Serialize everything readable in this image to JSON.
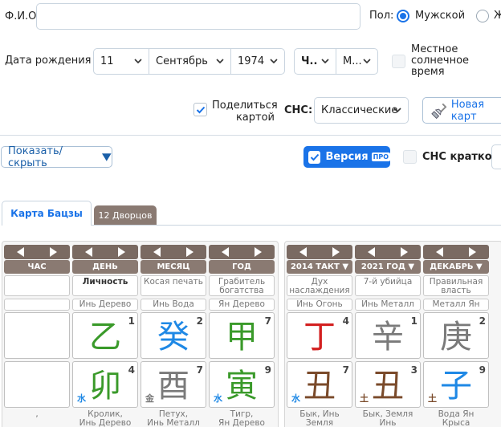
{
  "form": {
    "fio_label": "Ф.И.О.",
    "fio_value": "",
    "gender_label": "Пол:",
    "gender_male": "Мужской",
    "gender_female": "Ж",
    "birth_label": "Дата рождения",
    "day": "11",
    "month": "Сентябрь",
    "year": "1974",
    "hour": "Ч..",
    "minute": "М...",
    "solar_time_label": "Местное солнечное время",
    "share_label": "Поделиться картой",
    "sns_label": "СНС:",
    "sns_value": "Классические",
    "new_card_label": "Новая карт"
  },
  "toolbar": {
    "show_hide_label": "Показать/скрыть",
    "version_label": "Версия",
    "version_badge": "ПРО",
    "sns_short_label": "СНС кратко"
  },
  "tabs": [
    {
      "label": "Карта Бацзы"
    },
    {
      "label": "12 Дворцов"
    }
  ],
  "columns": [
    {
      "header": "ЧАС",
      "god": "",
      "stem_sub": "",
      "stem": "",
      "stem_num": "",
      "branch": "",
      "branch_num": "",
      "branch_elem": "",
      "bottom1": ",",
      "bottom2": ""
    },
    {
      "header": "ДЕНЬ",
      "god": "Личность",
      "stem_sub": "Инь Дерево",
      "stem": "乙",
      "stem_num": "1",
      "branch": "卯",
      "branch_num": "4",
      "branch_elem": "水",
      "bottom1": "Кролик,",
      "bottom2": "Инь Дерево"
    },
    {
      "header": "МЕСЯЦ",
      "god": "Косая печать",
      "stem_sub": "Инь Вода",
      "stem": "癸",
      "stem_num": "2",
      "branch": "酉",
      "branch_num": "7",
      "branch_elem": "金",
      "bottom1": "Петух,",
      "bottom2": "Инь Металл"
    },
    {
      "header": "ГОД",
      "god": "Грабитель богатства",
      "stem_sub": "Ян Дерево",
      "stem": "甲",
      "stem_num": "7",
      "branch": "寅",
      "branch_num": "9",
      "branch_elem": "水",
      "bottom1": "Тигр,",
      "bottom2": "Ян Дерево"
    },
    {
      "header": "2014 ТАКТ ▼",
      "god": "Дух наслаждения",
      "stem_sub": "Инь Огонь",
      "stem": "丁",
      "stem_num": "4",
      "branch": "丑",
      "branch_num": "7",
      "branch_elem": "水",
      "bottom1": "Бык, Инь",
      "bottom2": "Земля"
    },
    {
      "header": "2021 ГОД ▼",
      "god": "7-й убийца",
      "stem_sub": "Инь Металл",
      "stem": "辛",
      "stem_num": "1",
      "branch": "丑",
      "branch_num": "3",
      "branch_elem": "土",
      "bottom1": "Бык, Земля",
      "bottom2": "Инь"
    },
    {
      "header": "ДЕКАБРЬ ▼",
      "god": "Правильная власть",
      "stem_sub": "Металл Ян",
      "stem": "庚",
      "stem_num": "2",
      "branch": "子",
      "branch_num": "9",
      "branch_elem": "土",
      "bottom1": "Вода Ян",
      "bottom2": "Крыса"
    }
  ],
  "colors": {
    "accent": "#1a73e8",
    "wood": "#3a9a2a",
    "water": "#1e88e5",
    "metal": "#7a7a7a",
    "fire": "#d32020",
    "earth": "#7a4a2a",
    "header_bg": "#8a7a72"
  }
}
